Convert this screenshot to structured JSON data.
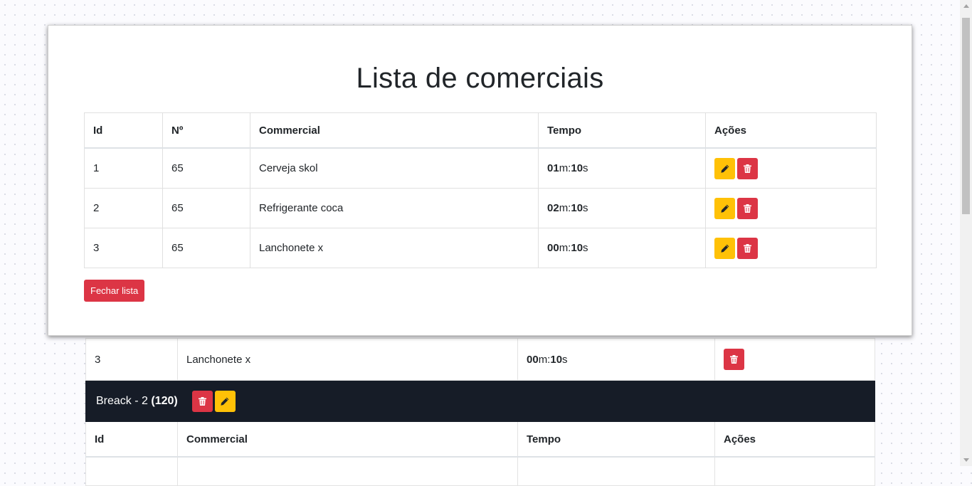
{
  "background": {
    "row": {
      "id": "3",
      "commercial": "Lanchonete x",
      "tempo_min": "00",
      "tempo_sec": "10"
    },
    "break": {
      "label": "Breack - 2",
      "count": "(120)"
    },
    "headers": {
      "id": "Id",
      "commercial": "Commercial",
      "tempo": "Tempo",
      "acoes": "Ações"
    }
  },
  "modal": {
    "title": "Lista de comerciais",
    "headers": {
      "id": "Id",
      "numero": "Nº",
      "commercial": "Commercial",
      "tempo": "Tempo",
      "acoes": "Ações"
    },
    "rows": [
      {
        "id": "1",
        "numero": "65",
        "commercial": "Cerveja skol",
        "tempo_min": "01",
        "tempo_sec": "10"
      },
      {
        "id": "2",
        "numero": "65",
        "commercial": "Refrigerante coca",
        "tempo_min": "02",
        "tempo_sec": "10"
      },
      {
        "id": "3",
        "numero": "65",
        "commercial": "Lanchonete x",
        "tempo_min": "00",
        "tempo_sec": "10"
      }
    ],
    "close_label": "Fechar lista"
  },
  "units": {
    "minutes": "m:",
    "seconds": "s"
  },
  "colors": {
    "warning": "#ffc107",
    "danger": "#dc3545",
    "dark_bar": "#161c27"
  },
  "icons": {
    "edit": "pencil-icon",
    "delete": "trash-icon"
  }
}
